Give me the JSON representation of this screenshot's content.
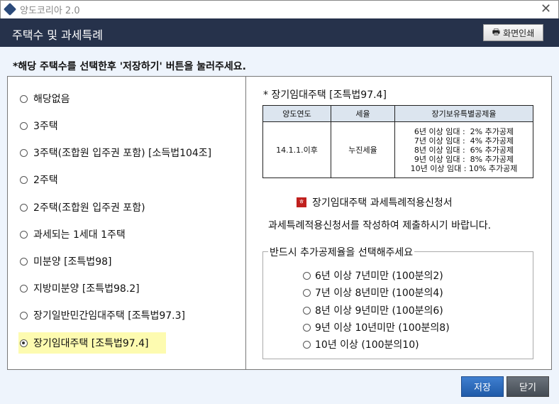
{
  "window": {
    "title": "양도코리아 2.0",
    "close": "✕"
  },
  "header": {
    "title": "주택수 및 과세특례",
    "print_label": "화면인쇄"
  },
  "instruction": "*해당 주택수를 선택한후 '저장하기' 버튼을 눌러주세요.",
  "options": [
    {
      "label": "해당없음",
      "selected": false
    },
    {
      "label": "3주택",
      "selected": false
    },
    {
      "label": "3주택(조합원 입주권 포함) [소득법104조]",
      "selected": false
    },
    {
      "label": "2주택",
      "selected": false
    },
    {
      "label": "2주택(조합원 입주권 포함)",
      "selected": false
    },
    {
      "label": "과세되는 1세대 1주택",
      "selected": false
    },
    {
      "label": "미분양 [조특법98]",
      "selected": false
    },
    {
      "label": "지방미분양 [조특법98.2]",
      "selected": false
    },
    {
      "label": "장기일반민간임대주택 [조특법97.3]",
      "selected": false
    },
    {
      "label": "장기임대주택 [조특법97.4]",
      "selected": true
    }
  ],
  "detail": {
    "title": "* 장기임대주택 [조특법97.4]",
    "table": {
      "headers": [
        "양도연도",
        "세율",
        "장기보유특별공제율"
      ],
      "row": {
        "year": "14.1.1.이후",
        "rate": "누진세율",
        "deductions": [
          "6년 이상 임대 :  2% 추가공제",
          "7년 이상 임대 :  4% 추가공제",
          "8년 이상 임대 :  6% 추가공제",
          "9년 이상 임대 :  8% 추가공제",
          "10년 이상 임대 : 10% 추가공제"
        ]
      }
    },
    "form_link": "장기임대주택  과세특례적용신청서",
    "form_desc": "과세특례적용신청서를 작성하여 제출하시기 바랍니다.",
    "group_title": "반드시 추가공제율을 선택해주세요",
    "group_options": [
      "6년 이상 7년미만 (100분의2)",
      "7년 이상 8년미만 (100분의4)",
      "8년 이상 9년미만 (100분의6)",
      "9년 이상 10년미만 (100분의8)",
      "10년 이상 (100분의10)"
    ]
  },
  "buttons": {
    "save": "저장",
    "close": "닫기"
  }
}
